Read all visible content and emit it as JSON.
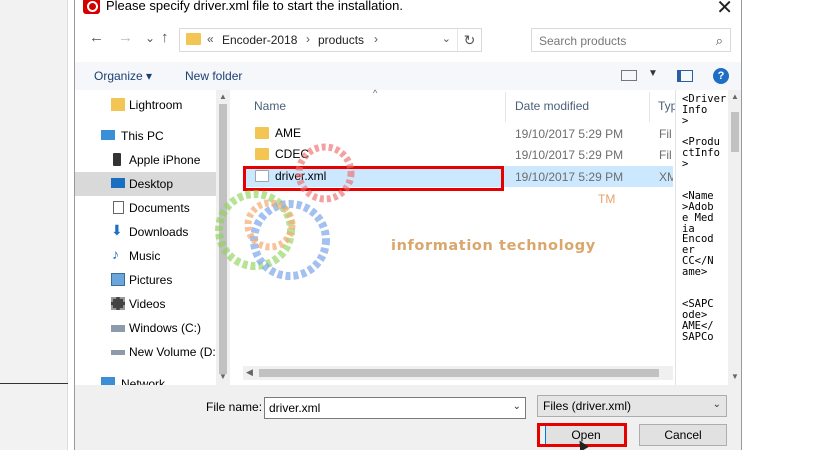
{
  "dialog": {
    "title": "Please specify driver.xml file to start the installation.",
    "close_glyph": "✕"
  },
  "nav_buttons": {
    "back": "←",
    "forward": "→",
    "recent": "⌄",
    "up": "↑"
  },
  "address": {
    "prefix": "«",
    "crumbs": [
      "Encoder-2018",
      "products"
    ],
    "separator": "›",
    "dropdown": "⌄",
    "refresh": "↻"
  },
  "search": {
    "placeholder": "Search products",
    "icon": "⌕"
  },
  "toolbar": {
    "organize": "Organize ▾",
    "new_folder": "New folder",
    "view_dropdown": "▼",
    "help": "?"
  },
  "nav_pane": {
    "items": [
      {
        "label": "Lightroom",
        "icon": "folder-icon"
      },
      {
        "label": "This PC",
        "icon": "computer-icon"
      },
      {
        "label": "Apple iPhone",
        "icon": "phone-icon"
      },
      {
        "label": "Desktop",
        "icon": "desktop-icon",
        "selected": true
      },
      {
        "label": "Documents",
        "icon": "documents-icon"
      },
      {
        "label": "Downloads",
        "icon": "downloads-icon"
      },
      {
        "label": "Music",
        "icon": "music-icon"
      },
      {
        "label": "Pictures",
        "icon": "pictures-icon"
      },
      {
        "label": "Videos",
        "icon": "videos-icon"
      },
      {
        "label": "Windows (C:)",
        "icon": "drive-icon"
      },
      {
        "label": "New Volume (D:",
        "icon": "drive-icon"
      },
      {
        "label": "Network",
        "icon": "network-icon"
      }
    ]
  },
  "file_list": {
    "columns": {
      "name": "Name",
      "date": "Date modified",
      "type": "Typ"
    },
    "sort_caret": "^",
    "rows": [
      {
        "name": "AME",
        "date": "19/10/2017 5:29 PM",
        "type": "Fil",
        "kind": "folder"
      },
      {
        "name": "CDEC",
        "date": "19/10/2017 5:29 PM",
        "type": "Fil",
        "kind": "folder"
      },
      {
        "name": "driver.xml",
        "date": "19/10/2017 5:29 PM",
        "type": "XM",
        "kind": "file",
        "selected": true
      }
    ]
  },
  "preview": {
    "text": "<Driver\nInfo\n>\n\n<Produ\nctInfo\n>\n\n\n<Name\n>Adob\ne Med\nia\nEncod\ner\nCC</N\name>\n\n\n<SAPC\node>\nAME</\nSAPCo"
  },
  "footer": {
    "file_name_label": "File name:",
    "file_name_value": "driver.xml",
    "filter_value": "Files (driver.xml)",
    "dropdown": "⌄",
    "open_label": "Open",
    "cancel_label": "Cancel"
  },
  "watermark": {
    "text": "information technology",
    "tm": "TM"
  },
  "colors": {
    "highlight": "#e60000",
    "selection": "#cce8ff",
    "accent": "#0078d7"
  }
}
